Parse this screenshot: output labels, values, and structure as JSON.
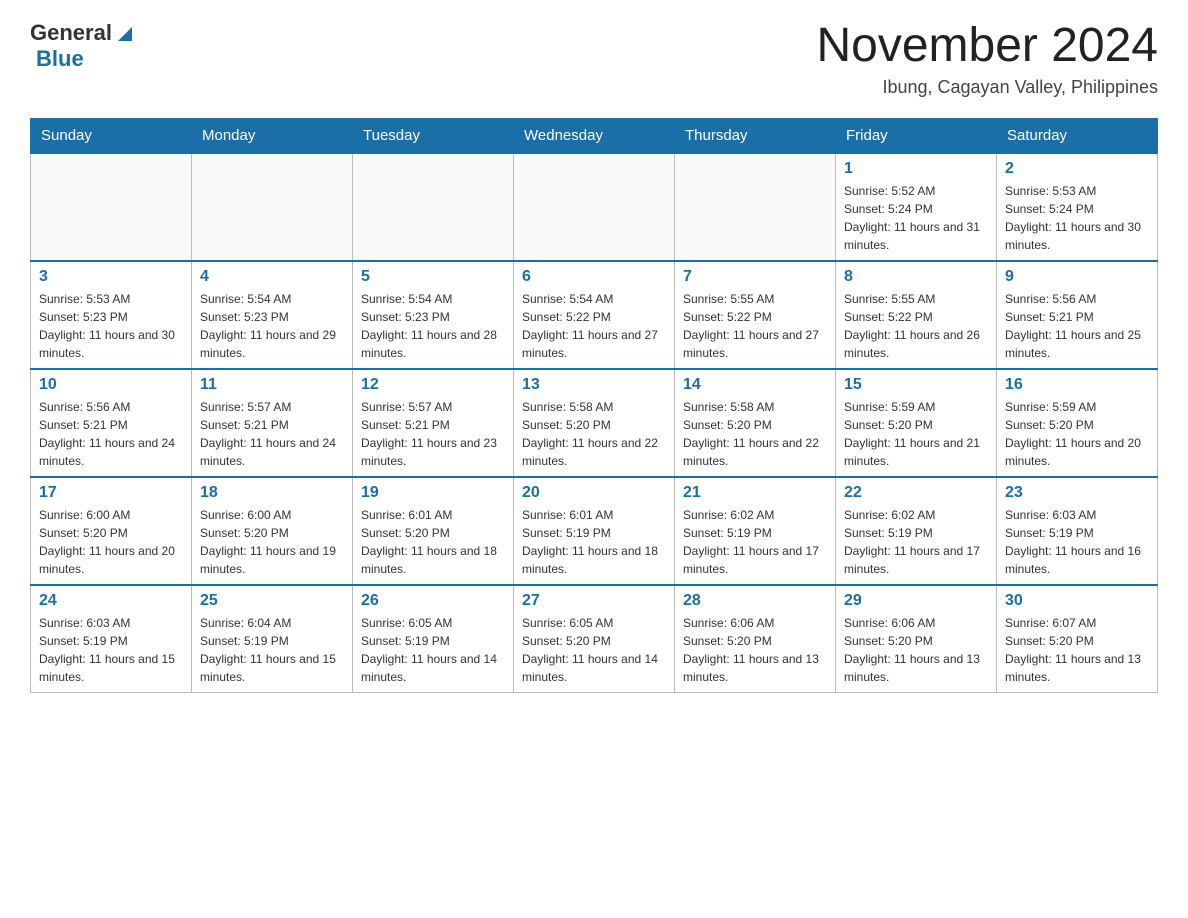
{
  "header": {
    "logo_general": "General",
    "logo_blue": "Blue",
    "month_title": "November 2024",
    "location": "Ibung, Cagayan Valley, Philippines"
  },
  "days_of_week": [
    "Sunday",
    "Monday",
    "Tuesday",
    "Wednesday",
    "Thursday",
    "Friday",
    "Saturday"
  ],
  "weeks": [
    {
      "days": [
        {
          "num": "",
          "info": ""
        },
        {
          "num": "",
          "info": ""
        },
        {
          "num": "",
          "info": ""
        },
        {
          "num": "",
          "info": ""
        },
        {
          "num": "",
          "info": ""
        },
        {
          "num": "1",
          "info": "Sunrise: 5:52 AM\nSunset: 5:24 PM\nDaylight: 11 hours and 31 minutes."
        },
        {
          "num": "2",
          "info": "Sunrise: 5:53 AM\nSunset: 5:24 PM\nDaylight: 11 hours and 30 minutes."
        }
      ]
    },
    {
      "days": [
        {
          "num": "3",
          "info": "Sunrise: 5:53 AM\nSunset: 5:23 PM\nDaylight: 11 hours and 30 minutes."
        },
        {
          "num": "4",
          "info": "Sunrise: 5:54 AM\nSunset: 5:23 PM\nDaylight: 11 hours and 29 minutes."
        },
        {
          "num": "5",
          "info": "Sunrise: 5:54 AM\nSunset: 5:23 PM\nDaylight: 11 hours and 28 minutes."
        },
        {
          "num": "6",
          "info": "Sunrise: 5:54 AM\nSunset: 5:22 PM\nDaylight: 11 hours and 27 minutes."
        },
        {
          "num": "7",
          "info": "Sunrise: 5:55 AM\nSunset: 5:22 PM\nDaylight: 11 hours and 27 minutes."
        },
        {
          "num": "8",
          "info": "Sunrise: 5:55 AM\nSunset: 5:22 PM\nDaylight: 11 hours and 26 minutes."
        },
        {
          "num": "9",
          "info": "Sunrise: 5:56 AM\nSunset: 5:21 PM\nDaylight: 11 hours and 25 minutes."
        }
      ]
    },
    {
      "days": [
        {
          "num": "10",
          "info": "Sunrise: 5:56 AM\nSunset: 5:21 PM\nDaylight: 11 hours and 24 minutes."
        },
        {
          "num": "11",
          "info": "Sunrise: 5:57 AM\nSunset: 5:21 PM\nDaylight: 11 hours and 24 minutes."
        },
        {
          "num": "12",
          "info": "Sunrise: 5:57 AM\nSunset: 5:21 PM\nDaylight: 11 hours and 23 minutes."
        },
        {
          "num": "13",
          "info": "Sunrise: 5:58 AM\nSunset: 5:20 PM\nDaylight: 11 hours and 22 minutes."
        },
        {
          "num": "14",
          "info": "Sunrise: 5:58 AM\nSunset: 5:20 PM\nDaylight: 11 hours and 22 minutes."
        },
        {
          "num": "15",
          "info": "Sunrise: 5:59 AM\nSunset: 5:20 PM\nDaylight: 11 hours and 21 minutes."
        },
        {
          "num": "16",
          "info": "Sunrise: 5:59 AM\nSunset: 5:20 PM\nDaylight: 11 hours and 20 minutes."
        }
      ]
    },
    {
      "days": [
        {
          "num": "17",
          "info": "Sunrise: 6:00 AM\nSunset: 5:20 PM\nDaylight: 11 hours and 20 minutes."
        },
        {
          "num": "18",
          "info": "Sunrise: 6:00 AM\nSunset: 5:20 PM\nDaylight: 11 hours and 19 minutes."
        },
        {
          "num": "19",
          "info": "Sunrise: 6:01 AM\nSunset: 5:20 PM\nDaylight: 11 hours and 18 minutes."
        },
        {
          "num": "20",
          "info": "Sunrise: 6:01 AM\nSunset: 5:19 PM\nDaylight: 11 hours and 18 minutes."
        },
        {
          "num": "21",
          "info": "Sunrise: 6:02 AM\nSunset: 5:19 PM\nDaylight: 11 hours and 17 minutes."
        },
        {
          "num": "22",
          "info": "Sunrise: 6:02 AM\nSunset: 5:19 PM\nDaylight: 11 hours and 17 minutes."
        },
        {
          "num": "23",
          "info": "Sunrise: 6:03 AM\nSunset: 5:19 PM\nDaylight: 11 hours and 16 minutes."
        }
      ]
    },
    {
      "days": [
        {
          "num": "24",
          "info": "Sunrise: 6:03 AM\nSunset: 5:19 PM\nDaylight: 11 hours and 15 minutes."
        },
        {
          "num": "25",
          "info": "Sunrise: 6:04 AM\nSunset: 5:19 PM\nDaylight: 11 hours and 15 minutes."
        },
        {
          "num": "26",
          "info": "Sunrise: 6:05 AM\nSunset: 5:19 PM\nDaylight: 11 hours and 14 minutes."
        },
        {
          "num": "27",
          "info": "Sunrise: 6:05 AM\nSunset: 5:20 PM\nDaylight: 11 hours and 14 minutes."
        },
        {
          "num": "28",
          "info": "Sunrise: 6:06 AM\nSunset: 5:20 PM\nDaylight: 11 hours and 13 minutes."
        },
        {
          "num": "29",
          "info": "Sunrise: 6:06 AM\nSunset: 5:20 PM\nDaylight: 11 hours and 13 minutes."
        },
        {
          "num": "30",
          "info": "Sunrise: 6:07 AM\nSunset: 5:20 PM\nDaylight: 11 hours and 13 minutes."
        }
      ]
    }
  ]
}
